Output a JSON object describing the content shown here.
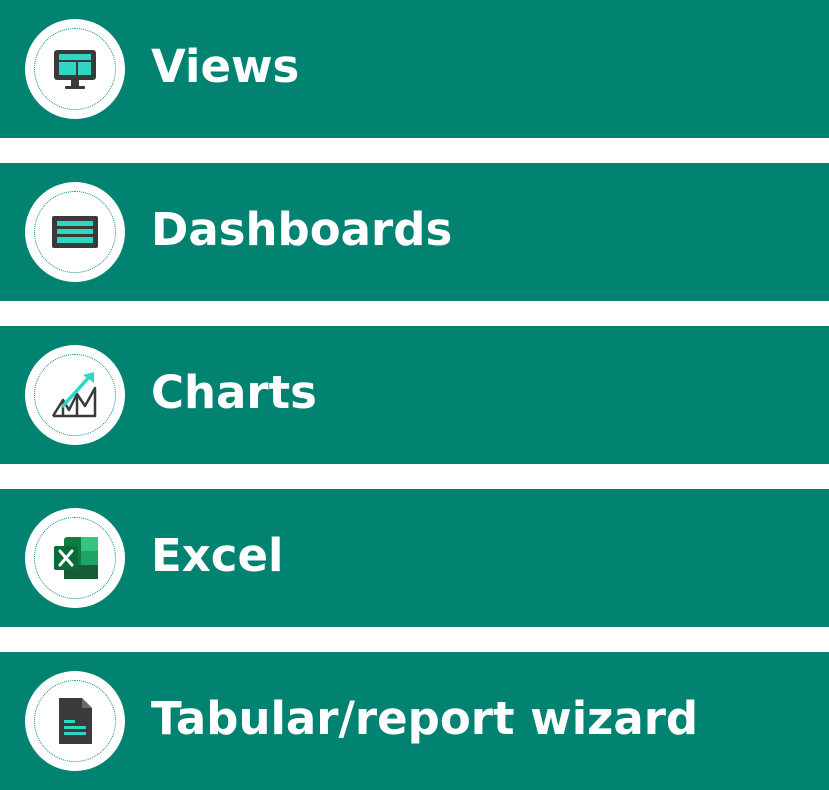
{
  "colors": {
    "row_background": "#028270",
    "icon_accent": "#2fd6c2",
    "icon_dark": "#3a3a3a"
  },
  "items": [
    {
      "label": "Views",
      "icon": "monitor-icon"
    },
    {
      "label": "Dashboards",
      "icon": "dashboard-icon"
    },
    {
      "label": "Charts",
      "icon": "chart-icon"
    },
    {
      "label": "Excel",
      "icon": "excel-icon"
    },
    {
      "label": "Tabular/report wizard",
      "icon": "report-document-icon"
    }
  ]
}
